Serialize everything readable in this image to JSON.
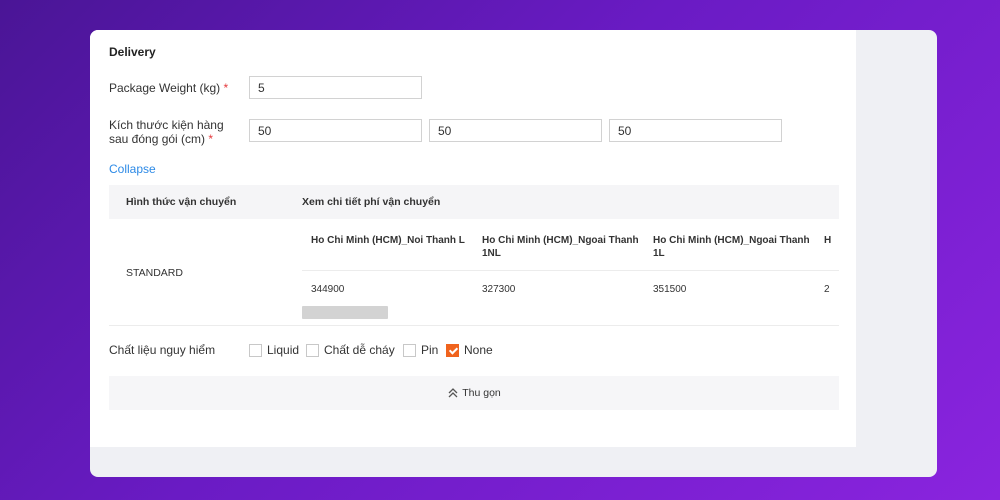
{
  "delivery": {
    "title": "Delivery",
    "weight_label": "Package Weight (kg)",
    "required_mark": "*",
    "weight_value": "5",
    "dims_label_line1": "Kích thước kiện hàng",
    "dims_label_line2": "sau đóng gói (cm)",
    "dims": [
      "50",
      "50",
      "50"
    ],
    "collapse_link": "Collapse"
  },
  "shipping": {
    "col_method": "Hình thức vận chuyển",
    "col_detail": "Xem chi tiết phí vận chuyển",
    "method": "STANDARD",
    "zones": [
      {
        "name": "Ho Chi Minh (HCM)_Noi Thanh L",
        "price": "344900"
      },
      {
        "name": "Ho Chi Minh (HCM)_Ngoai Thanh 1NL",
        "price": "327300"
      },
      {
        "name": "Ho Chi Minh (HCM)_Ngoai Thanh 1L",
        "price": "351500"
      },
      {
        "name": "H",
        "price": "2"
      }
    ]
  },
  "hazard": {
    "label": "Chất liệu nguy hiểm",
    "options": [
      {
        "label": "Liquid",
        "checked": false
      },
      {
        "label": "Chất dễ cháy",
        "checked": false
      },
      {
        "label": "Pin",
        "checked": false
      },
      {
        "label": "None",
        "checked": true
      }
    ]
  },
  "footer": {
    "collapse_label": "Thu gọn"
  },
  "colors": {
    "accent_orange": "#f0631d",
    "link_blue": "#2d8ae6",
    "required_red": "#e4393c"
  }
}
